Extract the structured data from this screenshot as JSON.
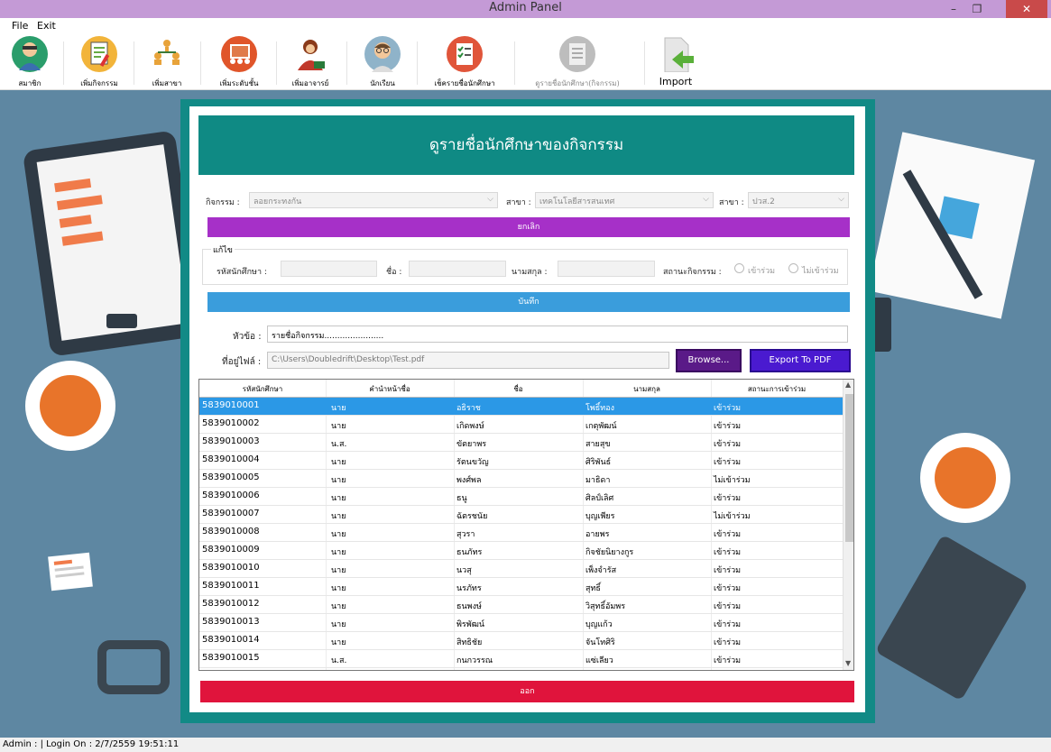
{
  "window": {
    "title": "Admin Panel",
    "min": "–",
    "max": "❐",
    "close": "✕"
  },
  "menu": [
    "File",
    "Exit"
  ],
  "toolbar": [
    {
      "label": "สมาชิก",
      "icon": "member-icon"
    },
    {
      "label": "เพิ่มกิจกรรม",
      "icon": "add-activity-icon"
    },
    {
      "label": "เพิ่มสาขา",
      "icon": "add-branch-icon"
    },
    {
      "label": "เพิ่มระดับชั้น",
      "icon": "add-level-icon"
    },
    {
      "label": "เพิ่มอาจารย์",
      "icon": "add-teacher-icon"
    },
    {
      "label": "นักเรียน",
      "icon": "student-icon"
    },
    {
      "label": "เช็ครายชื่อนักศึกษา",
      "icon": "check-names-icon"
    },
    {
      "label": "ดูรายชื่อนักศึกษา(กิจกรรม)",
      "icon": "view-names-icon"
    },
    {
      "label": "Import",
      "icon": "import-icon"
    }
  ],
  "dialog": {
    "heading": "ดูรายชื่อนักศึกษาของกิจกรรม",
    "activity_label": "กิจกรรม :",
    "activity_value": "ลอยกระทงกัน",
    "branch_label": "สาขา :",
    "branch_value": "เทคโนโลยีสารสนเทศ",
    "level_label": "สาขา :",
    "level_value": "ปวส.2",
    "cancel_button": "ยกเลิก",
    "edit_group": "แก้ไข",
    "student_id_label": "รหัสนักศึกษา :",
    "first_name_label": "ชื่อ :",
    "last_name_label": "นามสกุล :",
    "status_label": "สถานะกิจกรรม :",
    "radio_join": "เข้าร่วม",
    "radio_not_join": "ไม่เข้าร่วม",
    "save_button": "บันทึก",
    "topic_label": "หัวข้อ :",
    "topic_value": "รายชื่อกิจกรรม.......................",
    "file_label": "ที่อยู่ไฟล์ :",
    "file_value": "C:\\Users\\Doubledrift\\Desktop\\Test.pdf",
    "browse_button": "Browse...",
    "export_button": "Export To PDF",
    "exit_button": "ออก"
  },
  "table": {
    "columns": [
      "รหัสนักศึกษา",
      "คำนำหน้าชื่อ",
      "ชื่อ",
      "นามสกุล",
      "สถานะการเข้าร่วม"
    ],
    "rows": [
      [
        "5839010001",
        "นาย",
        "อธิราช",
        "โพธิ์ทอง",
        "เข้าร่วม"
      ],
      [
        "5839010002",
        "นาย",
        "เกิดพงษ์",
        "เกตุพัฒน์",
        "เข้าร่วม"
      ],
      [
        "5839010003",
        "น.ส.",
        "ขัตยาพร",
        "สายสุข",
        "เข้าร่วม"
      ],
      [
        "5839010004",
        "นาย",
        "รัตนขวัญ",
        "ศิริพันธ์",
        "เข้าร่วม"
      ],
      [
        "5839010005",
        "นาย",
        "พงศ์พล",
        "มาธิดา",
        "ไม่เข้าร่วม"
      ],
      [
        "5839010006",
        "นาย",
        "ธนู",
        "ศิลป์เลิศ",
        "เข้าร่วม"
      ],
      [
        "5839010007",
        "นาย",
        "ฉัตรชนัย",
        "บุญเพียร",
        "ไม่เข้าร่วม"
      ],
      [
        "5839010008",
        "นาย",
        "สุวรา",
        "อายพร",
        "เข้าร่วม"
      ],
      [
        "5839010009",
        "นาย",
        "ธนภัทร",
        "กิจชัยนิยางกูร",
        "เข้าร่วม"
      ],
      [
        "5839010010",
        "นาย",
        "นวสุ",
        "เพ็งจำรัส",
        "เข้าร่วม"
      ],
      [
        "5839010011",
        "นาย",
        "นรภัทร",
        "สุทธิ์",
        "เข้าร่วม"
      ],
      [
        "5839010012",
        "นาย",
        "ธนพงษ์",
        "วิสุทธิ์อัมพร",
        "เข้าร่วม"
      ],
      [
        "5839010013",
        "นาย",
        "พิรพัฒน์",
        "บุญแก้ว",
        "เข้าร่วม"
      ],
      [
        "5839010014",
        "นาย",
        "สิทธิชัย",
        "จันโทศิริ",
        "เข้าร่วม"
      ],
      [
        "5839010015",
        "น.ส.",
        "กนกวรรณ",
        "แซ่เลียว",
        "เข้าร่วม"
      ]
    ],
    "selected_row": 0
  },
  "status_bar": "Admin : | Login On : 2/7/2559 19:51:11"
}
